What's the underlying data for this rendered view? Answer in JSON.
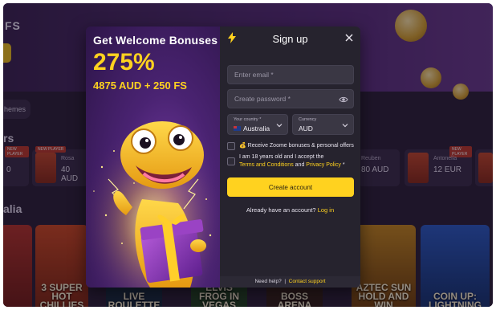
{
  "background": {
    "logo_text": "FS",
    "themes_label": "hemes",
    "heading_top": "rs",
    "heading_mid": "alia",
    "tiles": [
      {
        "badge": "NEW PLAYER",
        "name": "",
        "amount": "0"
      },
      {
        "badge": "NEW PLAYER",
        "name": "Rosa",
        "amount": "40 AUD"
      },
      {
        "badge": "",
        "name": "Reuben",
        "amount": "80 AUD"
      },
      {
        "badge": "NEW PLAYER",
        "name": "Antonella",
        "amount": "12 EUR"
      }
    ],
    "cards": [
      {
        "title": "3 SUPER HOT CHILLIES"
      },
      {
        "title": "LIVE ROULETTE"
      },
      {
        "title": "ELVIS FROG IN VEGAS"
      },
      {
        "title": "BOSS ARENA"
      },
      {
        "title": "AZTEC SUN HOLD AND WIN"
      },
      {
        "title": "COIN UP: LIGHTNING"
      }
    ]
  },
  "promo": {
    "title": "Get Welcome Bonuses",
    "percent": "275%",
    "amount": "4875 AUD + 250 FS"
  },
  "signup": {
    "title": "Sign up",
    "email_placeholder": "Enter email *",
    "password_placeholder": "Create password *",
    "country_label": "Your country *",
    "country_value": "Australia",
    "currency_label": "Currency",
    "currency_value": "AUD",
    "bonus_check_label": "Receive Zoome bonuses & personal offers",
    "bonus_emoji": "💰",
    "terms_prefix": "I am 18 years old and I accept the",
    "terms_link": "Terms and Conditions",
    "terms_and": "and",
    "privacy_link": "Privacy Policy",
    "terms_suffix": "*",
    "create_button": "Create account",
    "have_account": "Already have an account?",
    "login_link": "Log in",
    "need_help": "Need help?",
    "contact_support": "Contact support"
  },
  "icons": {
    "bolt": "lightning-icon",
    "close": "close-icon",
    "eye": "eye-icon",
    "chevron": "chevron-down-icon"
  },
  "colors": {
    "accent": "#ffd21f",
    "modal_bg": "#26232e",
    "promo_bg": "#4a2372"
  }
}
